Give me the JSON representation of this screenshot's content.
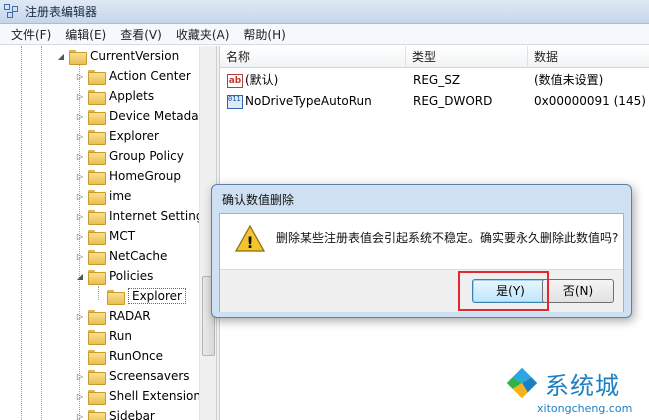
{
  "window": {
    "title": "注册表编辑器"
  },
  "menu": [
    "文件(F)",
    "编辑(E)",
    "查看(V)",
    "收藏夹(A)",
    "帮助(H)"
  ],
  "tree": {
    "parent": "CurrentVersion",
    "items": [
      {
        "label": "Action Center",
        "expander": "▷"
      },
      {
        "label": "Applets",
        "expander": "▷"
      },
      {
        "label": "Device Metada",
        "expander": "▷"
      },
      {
        "label": "Explorer",
        "expander": "▷"
      },
      {
        "label": "Group Policy",
        "expander": "▷"
      },
      {
        "label": "HomeGroup",
        "expander": "▷"
      },
      {
        "label": "ime",
        "expander": "▷"
      },
      {
        "label": "Internet Setting",
        "expander": "▷"
      },
      {
        "label": "MCT",
        "expander": "▷"
      },
      {
        "label": "NetCache",
        "expander": "▷"
      },
      {
        "label": "Policies",
        "expander": "◢"
      },
      {
        "label": "Explorer",
        "expander": ""
      },
      {
        "label": "RADAR",
        "expander": "▷"
      },
      {
        "label": "Run",
        "expander": ""
      },
      {
        "label": "RunOnce",
        "expander": ""
      },
      {
        "label": "Screensavers",
        "expander": "▷"
      },
      {
        "label": "Shell Extension",
        "expander": "▷"
      },
      {
        "label": "Sidebar",
        "expander": "▷"
      }
    ],
    "parent_expander": "◢"
  },
  "list": {
    "columns": [
      "名称",
      "类型",
      "数据"
    ],
    "rows": [
      {
        "icon": "ab",
        "name": "(默认)",
        "type": "REG_SZ",
        "data": "(数值未设置)"
      },
      {
        "icon": "011 110",
        "name": "NoDriveTypeAutoRun",
        "type": "REG_DWORD",
        "data": "0x00000091 (145)"
      }
    ]
  },
  "dialog": {
    "title": "确认数值删除",
    "message": "删除某些注册表值会引起系统不稳定。确实要永久删除此数值吗?",
    "yes_label": "是(Y)",
    "no_label": "否(N)",
    "warning_mark": "!"
  },
  "watermark": {
    "title": "系统城",
    "url": "xitongcheng.com"
  },
  "colors": {
    "highlight": "#e0282e",
    "watermark": "#1d7fc2"
  }
}
